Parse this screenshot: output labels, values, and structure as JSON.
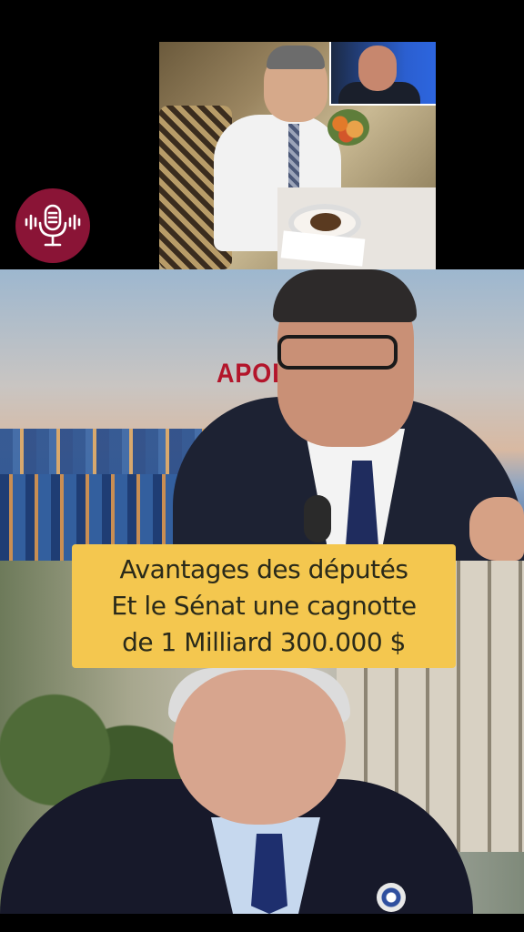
{
  "caption": {
    "line1": "Avantages des députés",
    "line2": "Et le Sénat une cagnotte",
    "line3": "de 1 Milliard 300.000 $"
  },
  "video_frame": {
    "banner_text": "APOLL        10"
  },
  "colors": {
    "caption_bg": "#f4c74f",
    "podcast_badge": "#8a1436",
    "banner_red": "#b3152b"
  },
  "icons": [
    "podcast-microphone-icon"
  ]
}
